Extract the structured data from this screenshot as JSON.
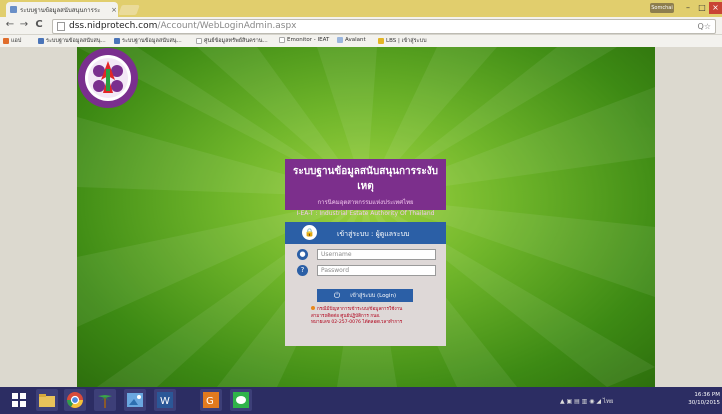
{
  "browser": {
    "tab_title": "ระบบฐานข้อมูลสนับสนุนการระ",
    "tab_close": "×",
    "user_button": "Somchai",
    "win_min": "–",
    "win_max": "□",
    "win_close": "×",
    "back": "←",
    "forward": "→",
    "reload": "C",
    "url_domain": "dss.nidprotech.com",
    "url_path": "/Account/WebLoginAdmin.aspx",
    "url_right": "Q☆",
    "bookmarks": [
      "แอป",
      "ระบบฐานข้อมูลสนับสนุ...",
      "ระบบฐานข้อมูลสนับสนุ...",
      "ศูนย์ข้อมูลทรัพย์สินคราน...",
      "Emonitor - IEAT",
      "Avalant",
      "LBS | เข้าสู่ระบบ"
    ]
  },
  "page": {
    "banner_title": "ระบบฐานข้อมูลสนับสนุนการระงับเหตุ",
    "banner_sub_th": "การนิคมอุตสาหกรรมแห่งประเทศไทย",
    "banner_sub_en": "I-EA-T : Industrial Estate Authority Of Thailand",
    "login_header": "เข้าสู่ระบบ : ผู้ดูแลระบบ",
    "username_placeholder": "Username",
    "password_placeholder": "Password",
    "login_button": "เข้าสู่ระบบ (Login)",
    "power_symbol": "⏻",
    "note_line1": "กรณีมีปัญหาการเข้าระบบ/ข้อมูลการใช้งาน",
    "note_line2": "สามารถติดต่อ ศูนย์ปฏิบัติการ กนอ.",
    "note_line3": "หมายเลข 02-257-0076 ได้ตลอดเวลาทำการ",
    "colors": {
      "header_blue": "#2b5fa6",
      "banner_purple": "#7c2f8c",
      "bg_green": "#6fb52a"
    }
  },
  "taskbar": {
    "icons": [
      "start-windows-icon",
      "file-explorer-icon",
      "chrome-icon",
      "palm-tree-app-icon",
      "image-viewer-icon",
      "word-icon",
      "g-app-icon",
      "chat-app-icon"
    ],
    "tray_text": "ไทย",
    "time": "16:36 PM",
    "date": "30/10/2015"
  }
}
